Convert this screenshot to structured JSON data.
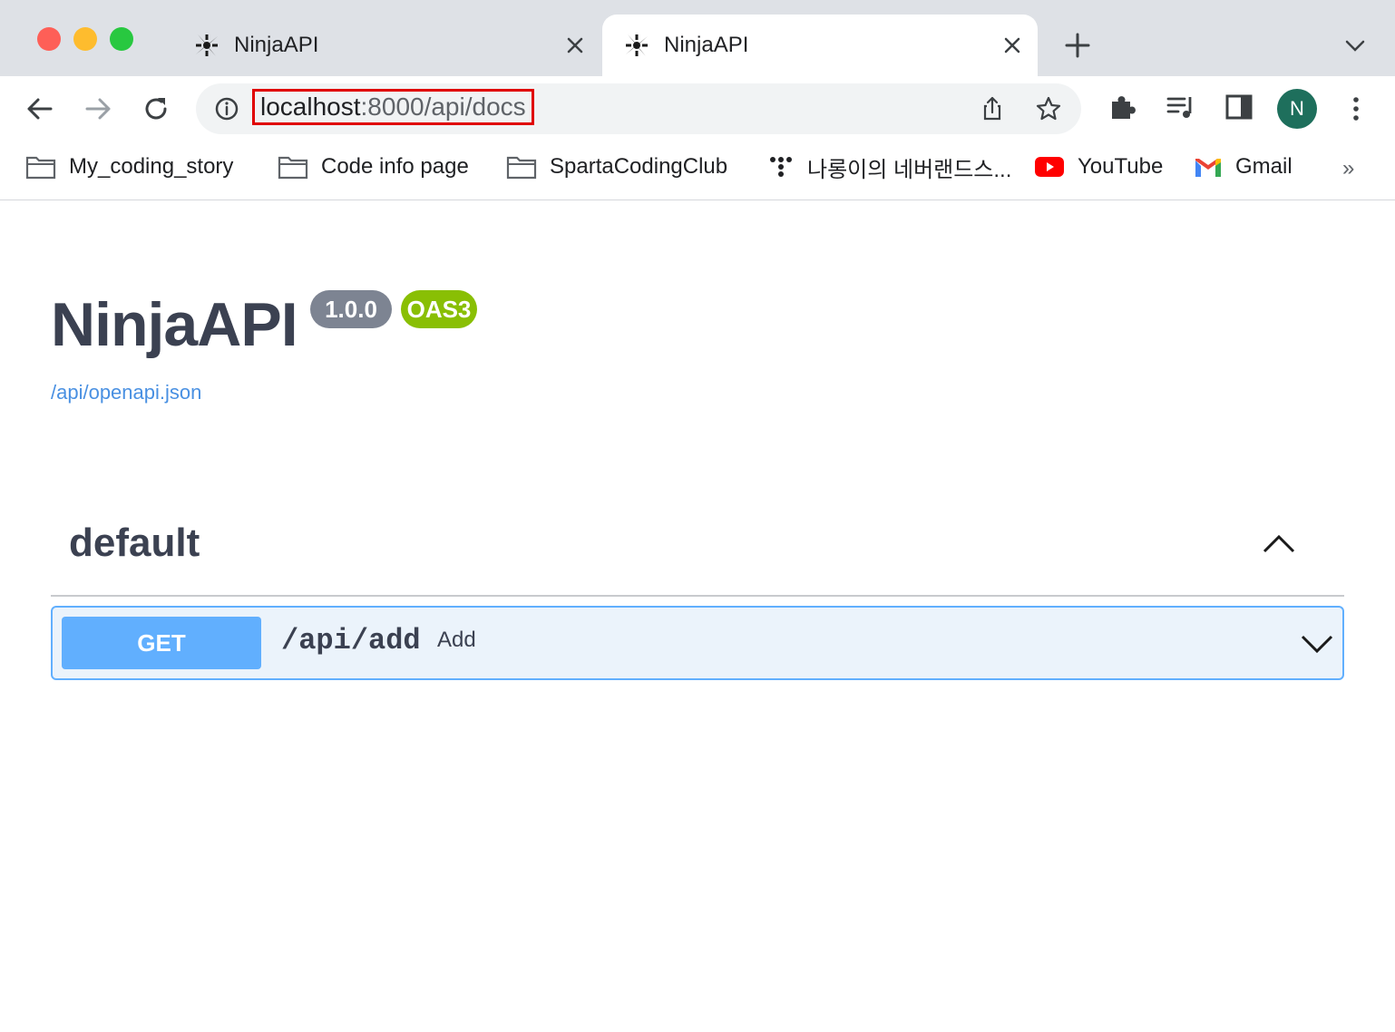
{
  "browser": {
    "tabs": [
      {
        "title": "NinjaAPI",
        "active": false
      },
      {
        "title": "NinjaAPI",
        "active": true
      }
    ],
    "address": {
      "host": "localhost",
      "path": ":8000/api/docs"
    },
    "profile_initial": "N",
    "bookmarks": [
      {
        "label": "My_coding_story",
        "icon": "folder-icon"
      },
      {
        "label": "Code info page",
        "icon": "folder-icon"
      },
      {
        "label": "SpartaCodingClub",
        "icon": "folder-icon"
      },
      {
        "label": "나롱이의 네버랜드스...",
        "icon": "dots-logo-icon"
      },
      {
        "label": "YouTube",
        "icon": "youtube-icon"
      },
      {
        "label": "Gmail",
        "icon": "gmail-icon"
      }
    ],
    "bookmarks_overflow": "»"
  },
  "swagger": {
    "title": "NinjaAPI",
    "version": "1.0.0",
    "oas_badge": "OAS3",
    "spec_link": "/api/openapi.json",
    "section": "default",
    "operations": [
      {
        "method": "GET",
        "path": "/api/add",
        "summary": "Add"
      }
    ]
  },
  "colors": {
    "get_accent": "#61affe",
    "get_background": "#ebf3fb",
    "oas_badge": "#89bf04",
    "version_badge": "#7d8492",
    "url_highlight": "#e00000"
  }
}
